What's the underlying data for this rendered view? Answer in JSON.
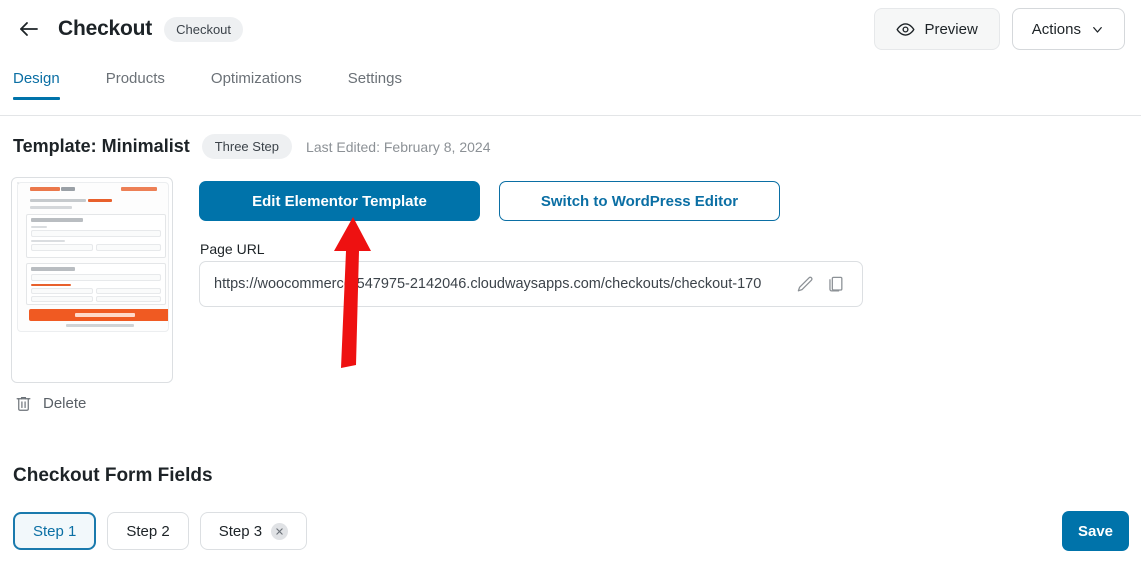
{
  "header": {
    "back_icon": "arrow-left-icon",
    "title": "Checkout",
    "badge": "Checkout",
    "preview_label": "Preview",
    "preview_icon": "eye-icon",
    "actions_label": "Actions",
    "actions_icon": "chevron-down-icon"
  },
  "tabs": [
    {
      "label": "Design",
      "active": true
    },
    {
      "label": "Products",
      "active": false
    },
    {
      "label": "Optimizations",
      "active": false
    },
    {
      "label": "Settings",
      "active": false
    }
  ],
  "template": {
    "title": "Template: Minimalist",
    "badge": "Three Step",
    "last_edited": "Last Edited: February 8, 2024",
    "thumbnail_alt": "checkout-template-preview"
  },
  "actions": {
    "edit_elementor": "Edit Elementor Template",
    "switch_wordpress": "Switch to WordPress Editor",
    "delete_label": "Delete",
    "delete_icon": "trash-icon"
  },
  "page_url": {
    "label": "Page URL",
    "value": "https://woocommerce-547975-2142046.cloudwaysapps.com/checkouts/checkout-170",
    "edit_icon": "pencil-icon",
    "copy_icon": "copy-icon"
  },
  "form_fields": {
    "title": "Checkout Form Fields",
    "steps": [
      {
        "label": "Step 1",
        "active": true,
        "closable": false
      },
      {
        "label": "Step 2",
        "active": false,
        "closable": false
      },
      {
        "label": "Step 3",
        "active": false,
        "closable": true,
        "close_icon": "close-icon"
      }
    ],
    "save_label": "Save"
  },
  "annotation": {
    "arrow_icon": "red-arrow-up-annotation",
    "color": "#ee1111"
  },
  "colors": {
    "primary_blue": "#0073aa",
    "link_blue": "#0b6fa4",
    "badge_gray": "#eef0f2",
    "muted_text": "#8c9196",
    "border": "#dcdfe2",
    "accent_orange": "#f05a22"
  }
}
